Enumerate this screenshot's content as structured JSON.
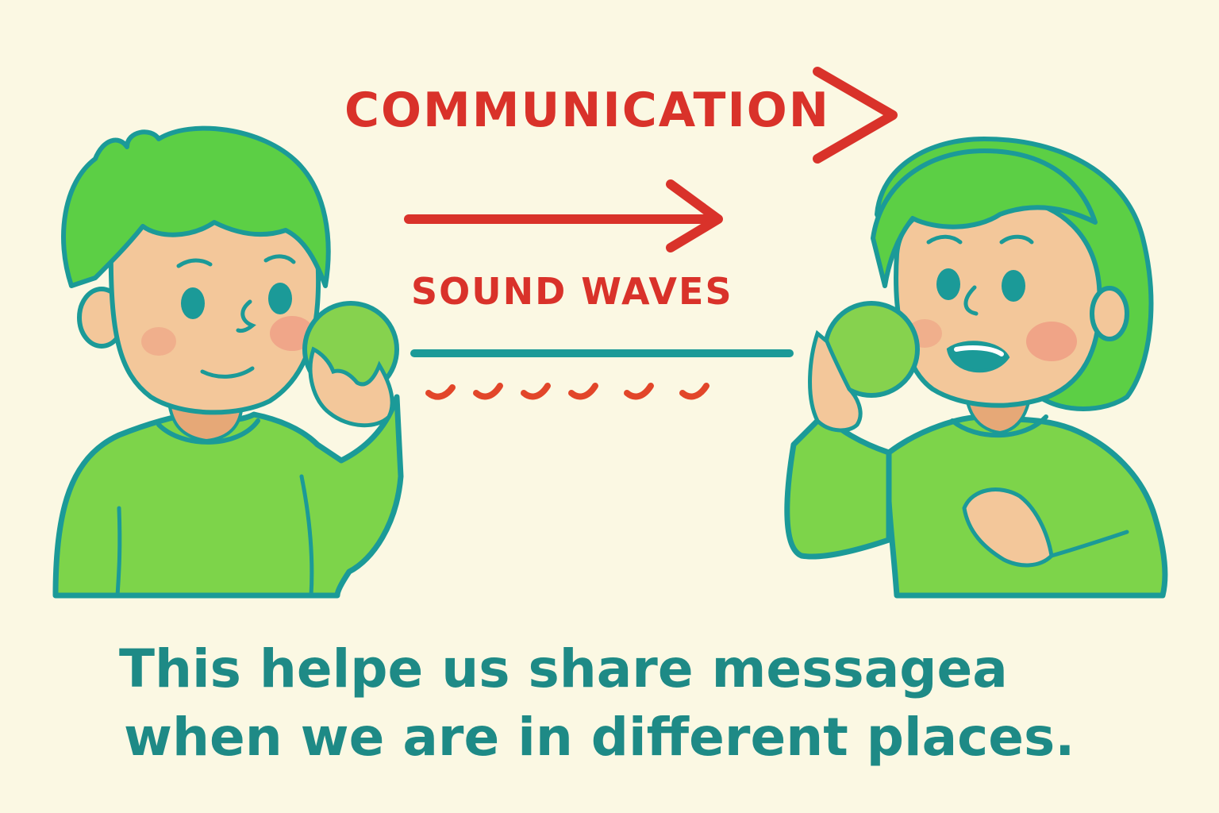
{
  "labels": {
    "communication": "COMMUNICATION",
    "sound_waves": "SOUND WAVES"
  },
  "caption": {
    "line1": "This helpe us share messagea",
    "line2": "when we are in different places."
  },
  "colors": {
    "background": "#fbf8e3",
    "label_red": "#d9322a",
    "caption_teal": "#1e8a86",
    "shirt_green": "#7dd44a",
    "hair_green": "#5ccf45",
    "skin": "#f3c79a",
    "outline_teal": "#1b9a98"
  }
}
